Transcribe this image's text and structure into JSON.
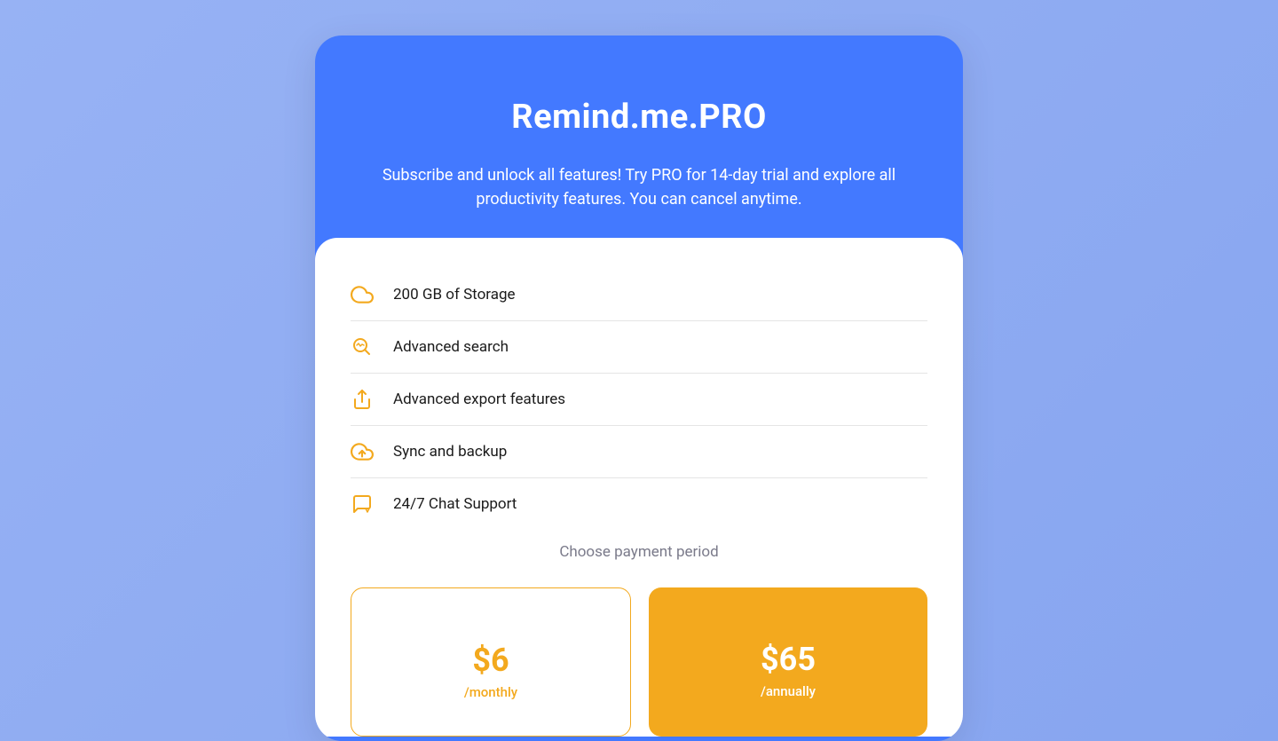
{
  "header": {
    "title": "Remind.me.PRO",
    "subtitle": "Subscribe and unlock all features! Try PRO for 14-day trial and explore all productivity features. You can cancel anytime."
  },
  "features": [
    {
      "icon": "cloud-icon",
      "label": "200 GB of Storage"
    },
    {
      "icon": "search-icon",
      "label": "Advanced search"
    },
    {
      "icon": "export-icon",
      "label": "Advanced export features"
    },
    {
      "icon": "sync-icon",
      "label": "Sync and backup"
    },
    {
      "icon": "chat-icon",
      "label": "24/7 Chat Support"
    }
  ],
  "choose_label": "Choose payment period",
  "plans": {
    "monthly": {
      "price": "$6",
      "period": "/monthly",
      "selected": false
    },
    "annually": {
      "price": "$65",
      "period": "/annually",
      "selected": true
    }
  },
  "colors": {
    "accent": "#4379ff",
    "highlight": "#f3a91e",
    "background": "#8fa9f2"
  }
}
